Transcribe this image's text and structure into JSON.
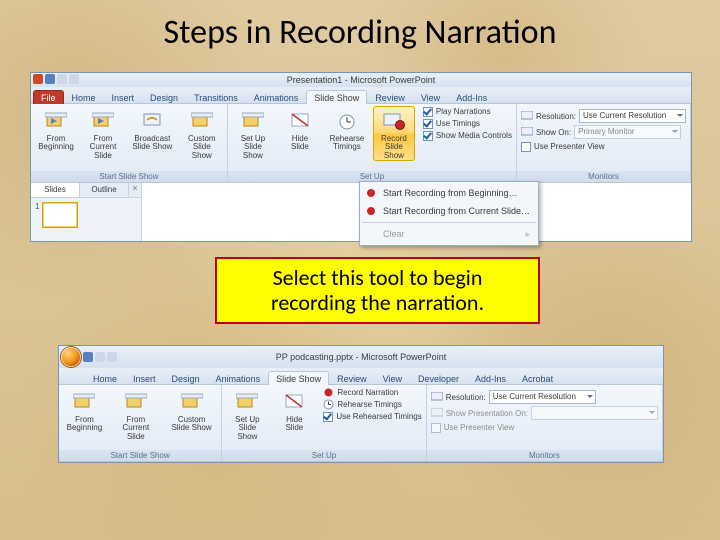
{
  "slide": {
    "title": "Steps in Recording Narration",
    "callout": "Select this tool to begin recording the narration."
  },
  "app1": {
    "title": "Presentation1 - Microsoft PowerPoint",
    "tabs": {
      "file": "File",
      "home": "Home",
      "insert": "Insert",
      "design": "Design",
      "transitions": "Transitions",
      "animations": "Animations",
      "slideshow": "Slide Show",
      "review": "Review",
      "view": "View",
      "addins": "Add-Ins"
    },
    "ribbon": {
      "from_beginning": "From Beginning",
      "from_current": "From Current Slide",
      "broadcast": "Broadcast Slide Show",
      "custom": "Custom Slide Show",
      "group_start": "Start Slide Show",
      "setup": "Set Up Slide Show",
      "hide": "Hide Slide",
      "rehearse": "Rehearse Timings",
      "record": "Record Slide Show",
      "play_narrations": "Play Narrations",
      "use_timings": "Use Timings",
      "show_media": "Show Media Controls",
      "group_setup": "Set Up",
      "resolution_lbl": "Resolution:",
      "resolution_val": "Use Current Resolution",
      "show_on_lbl": "Show On:",
      "show_on_val": "Primary Monitor",
      "presenter": "Use Presenter View",
      "group_monitors": "Monitors"
    },
    "menu": {
      "from_beginning": "Start Recording from Beginning…",
      "from_current": "Start Recording from Current Slide…",
      "clear": "Clear"
    },
    "leftpanel": {
      "slides": "Slides",
      "outline": "Outline",
      "num1": "1"
    }
  },
  "app2": {
    "title": "PP podcasting.pptx - Microsoft PowerPoint",
    "tabs": {
      "home": "Home",
      "insert": "Insert",
      "design": "Design",
      "animations": "Animations",
      "slideshow": "Slide Show",
      "review": "Review",
      "view": "View",
      "developer": "Developer",
      "addins": "Add-Ins",
      "acrobat": "Acrobat"
    },
    "ribbon": {
      "from_beginning": "From Beginning",
      "from_current": "From Current Slide",
      "custom": "Custom Slide Show",
      "group_start": "Start Slide Show",
      "setup": "Set Up Slide Show",
      "hide": "Hide Slide",
      "record_narration": "Record Narration",
      "rehearse": "Rehearse Timings",
      "use_rehearsed": "Use Rehearsed Timings",
      "group_setup": "Set Up",
      "resolution_lbl": "Resolution:",
      "resolution_val": "Use Current Resolution",
      "show_on_lbl": "Show Presentation On:",
      "presenter": "Use Presenter View",
      "group_monitors": "Monitors"
    }
  }
}
